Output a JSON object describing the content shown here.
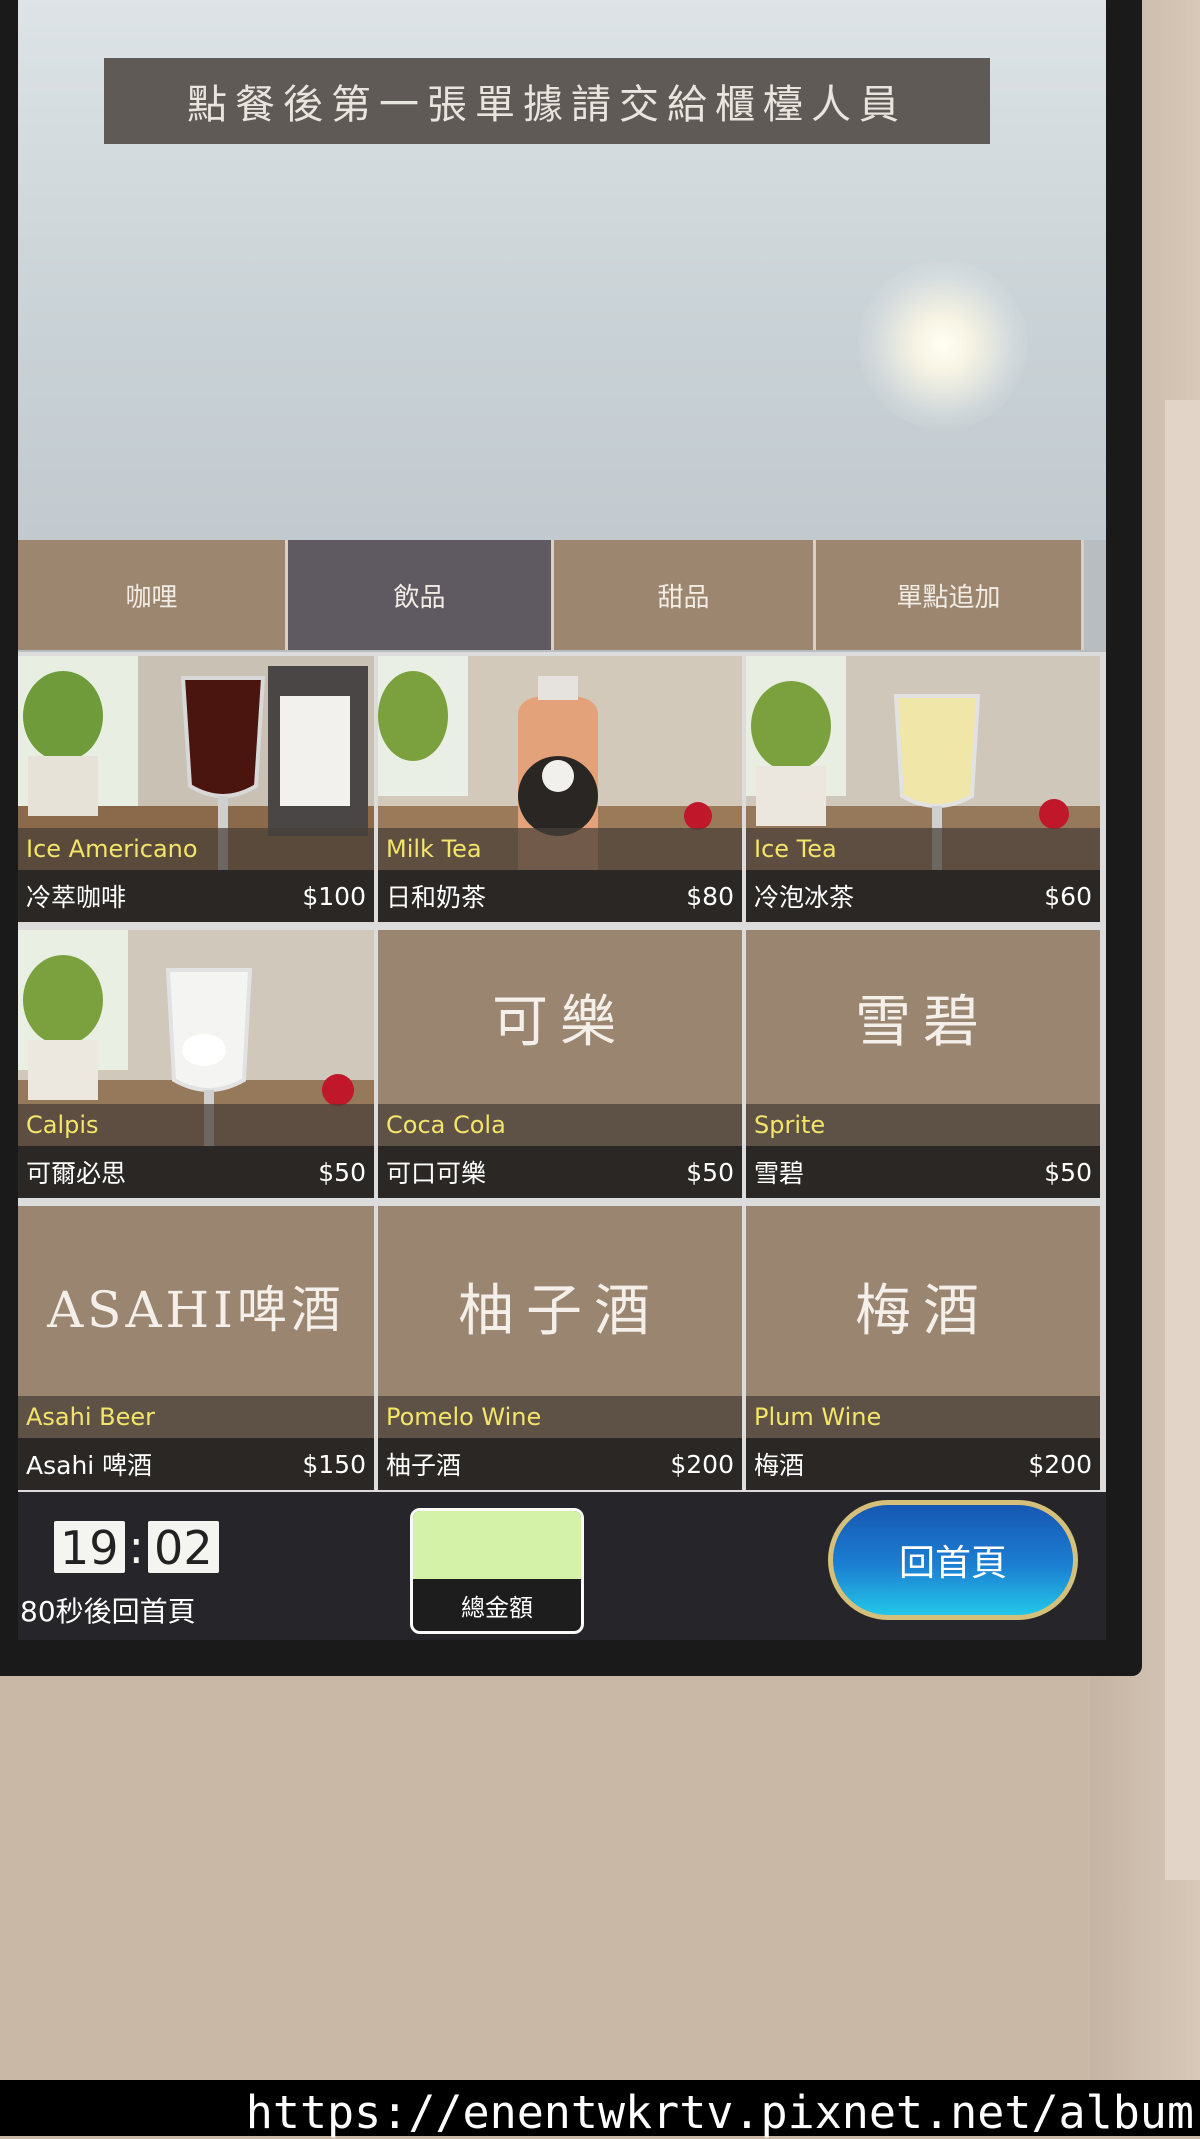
{
  "notice": "點餐後第一張單據請交給櫃檯人員",
  "tabs": [
    {
      "label": "咖哩",
      "active": false
    },
    {
      "label": "飲品",
      "active": true
    },
    {
      "label": "甜品",
      "active": false
    },
    {
      "label": "單點追加",
      "active": false
    }
  ],
  "items": [
    {
      "en": "Ice Americano",
      "zh": "冷萃咖啡",
      "price": "$100"
    },
    {
      "en": "Milk Tea",
      "zh": "日和奶茶",
      "price": "$80"
    },
    {
      "en": "Ice Tea",
      "zh": "冷泡冰茶",
      "price": "$60"
    },
    {
      "en": "Calpis",
      "zh": "可爾必思",
      "price": "$50"
    },
    {
      "en": "Coca Cola",
      "zh": "可口可樂",
      "price": "$50",
      "display": "可樂"
    },
    {
      "en": "Sprite",
      "zh": "雪碧",
      "price": "$50",
      "display": "雪碧"
    },
    {
      "en": "Asahi Beer",
      "zh": "Asahi 啤酒",
      "price": "$150",
      "display": "ASAHI啤酒"
    },
    {
      "en": "Pomelo Wine",
      "zh": "柚子酒",
      "price": "$200",
      "display": "柚子酒"
    },
    {
      "en": "Plum Wine",
      "zh": "梅酒",
      "price": "$200",
      "display": "梅酒"
    }
  ],
  "bottom": {
    "hour": "19",
    "minute": "02",
    "countdown": "80秒後回首頁",
    "total_label": "總金額",
    "home_label": "回首頁"
  },
  "watermark": "https://enentwkrtv.pixnet.net/album",
  "colors": {
    "tab_bg": "#9c8670",
    "tab_active": "#5f5a62",
    "english_name": "#f3e46a",
    "home_button": "#1c7fd2",
    "total_amount_bg": "#d4f3a8"
  }
}
